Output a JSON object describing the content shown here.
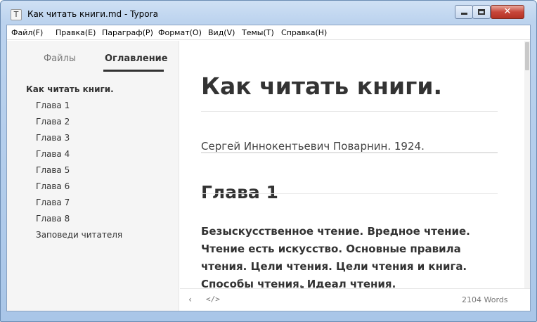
{
  "window": {
    "title": "Как читать книги.md - Typora",
    "app_icon": "T",
    "minimize_glyph": "minimize-icon",
    "maximize_glyph": "maximize-icon",
    "close_glyph": "✕"
  },
  "menubar": {
    "items": [
      {
        "label": "Файл(F)"
      },
      {
        "label": "Правка(E)"
      },
      {
        "label": "Параграф(P)"
      },
      {
        "label": "Формат(O)"
      },
      {
        "label": "Вид(V)"
      },
      {
        "label": "Темы(T)"
      },
      {
        "label": "Справка(H)"
      }
    ]
  },
  "sidebar": {
    "tabs": [
      {
        "label": "Файлы",
        "active": false
      },
      {
        "label": "Оглавление",
        "active": true
      }
    ],
    "outline": [
      {
        "label": "Как читать книги.",
        "level": 1
      },
      {
        "label": "Глава 1",
        "level": 2
      },
      {
        "label": "Глава 2",
        "level": 2
      },
      {
        "label": "Глава 3",
        "level": 2
      },
      {
        "label": "Глава 4",
        "level": 2
      },
      {
        "label": "Глава 5",
        "level": 2
      },
      {
        "label": "Глава 6",
        "level": 2
      },
      {
        "label": "Глава 7",
        "level": 2
      },
      {
        "label": "Глава 8",
        "level": 2
      },
      {
        "label": "Заповеди читателя",
        "level": 2
      }
    ]
  },
  "editor": {
    "title": "Как читать книги.",
    "author": "Сергей Иннокентьевич Поварнин. 1924.",
    "heading": "Глава 1",
    "paragraph": "Безыскусственное чтение. Вредное чтение. Чтение есть искусство. Основные правила чтения. Цели чтения. Цели чтения и книга. Способы чтения. Идеал чтения."
  },
  "statusbar": {
    "back_glyph": "‹",
    "source_glyph": "</>",
    "word_count": "2104 Words"
  },
  "colors": {
    "sidebar_bg": "#f5f5f5",
    "text": "#333333",
    "muted": "#777777",
    "window_frame": "#bcd3ee",
    "close_button": "#c7463a"
  }
}
